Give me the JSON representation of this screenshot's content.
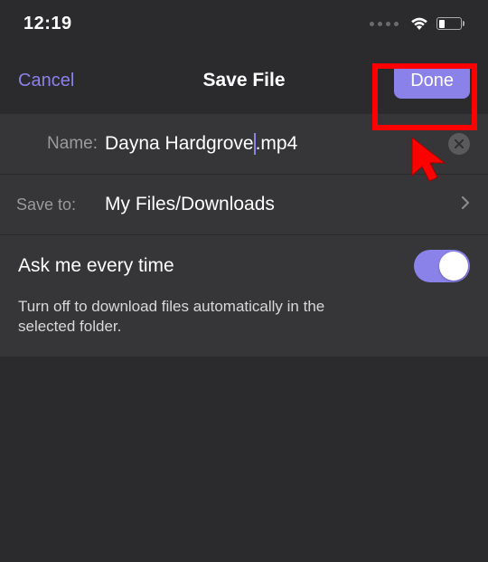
{
  "status": {
    "time": "12:19"
  },
  "nav": {
    "cancel": "Cancel",
    "title": "Save File",
    "done": "Done"
  },
  "name_row": {
    "label": "Name:",
    "value_before": "Dayna Hardgrove",
    "value_after": ".mp4"
  },
  "saveto_row": {
    "label": "Save to:",
    "value": "My Files/Downloads"
  },
  "ask": {
    "title": "Ask me every time",
    "description": "Turn off to download files automatically in the selected folder.",
    "enabled": true
  }
}
